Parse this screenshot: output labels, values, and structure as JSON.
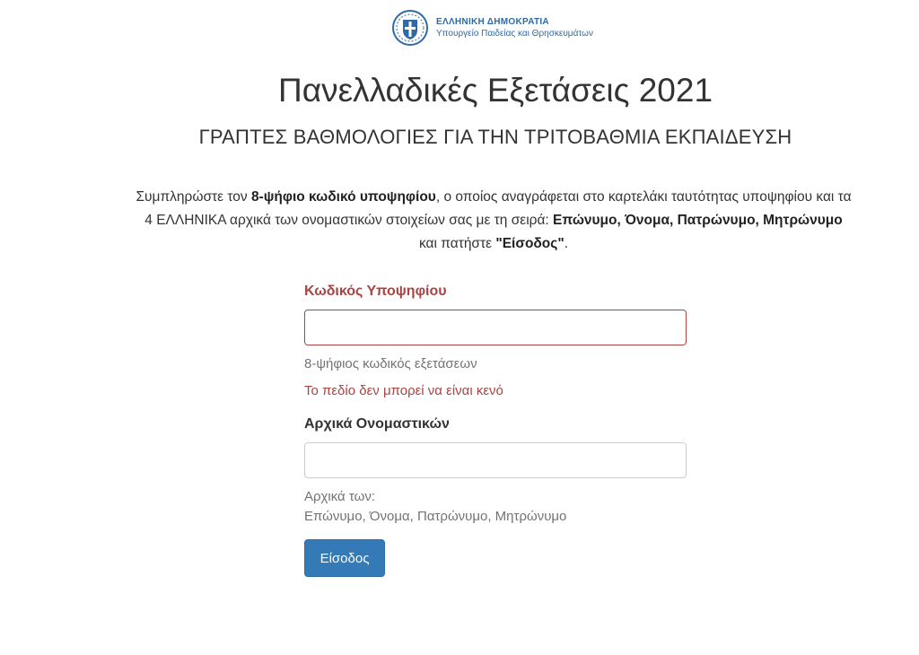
{
  "header": {
    "org_line1": "ΕΛΛΗΝΙΚΗ ΔΗΜΟΚΡΑΤΙΑ",
    "org_line2": "Υπουργείο Παιδείας και Θρησκευμάτων",
    "emblem_icon": "greek-emblem-icon"
  },
  "page": {
    "title": "Πανελλαδικές Εξετάσεις 2021",
    "subtitle": "ΓΡΑΠΤΕΣ ΒΑΘΜΟΛΟΓΙΕΣ ΓΙΑ ΤΗΝ ΤΡΙΤΟΒΑΘΜΙΑ ΕΚΠΑΙΔΕΥΣΗ"
  },
  "instructions": {
    "t1": "Συμπληρώστε τον ",
    "b1": "8-ψήφιο κωδικό υποψηφίου",
    "t2": ", ο οποίος αναγράφεται στο καρτελάκι ταυτότητας υποψηφίου και τα 4 ΕΛΛΗΝΙΚΑ αρχικά των ονομαστικών στοιχείων σας με τη σειρά: ",
    "b2": "Επώνυμο, Όνομα, Πατρώνυμο, Μητρώνυμο",
    "t3": " και πατήστε ",
    "b3": "\"Είσοδος\"",
    "t4": "."
  },
  "form": {
    "code": {
      "label": "Κωδικός Υποψηφίου",
      "value": "",
      "help": "8-ψήφιος κωδικός εξετάσεων",
      "error": "Το πεδίο δεν μπορεί να είναι κενό"
    },
    "initials": {
      "label": "Αρχικά Ονομαστικών",
      "value": "",
      "help_line1": "Αρχικά των:",
      "help_line2": "Επώνυμο, Όνομα, Πατρώνυμο, Μητρώνυμο"
    },
    "submit_label": "Είσοδος"
  },
  "colors": {
    "error": "#a94442",
    "primary": "#337ab7",
    "brand": "#2f6aa8"
  }
}
